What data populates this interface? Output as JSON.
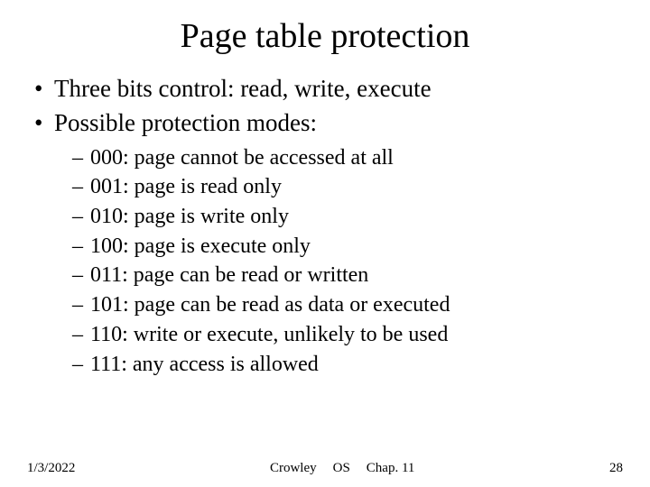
{
  "title": "Page table protection",
  "bullets": [
    "Three bits control: read, write, execute",
    "Possible protection modes:"
  ],
  "sublist": [
    "000: page cannot be accessed at all",
    "001: page is read only",
    "010: page is write only",
    "100: page is execute only",
    "011: page can be read or written",
    "101: page can be read as data or executed",
    "110: write or execute, unlikely to be used",
    "111: any access is allowed"
  ],
  "footer": {
    "date": "1/3/2022",
    "author": "Crowley",
    "subject": "OS",
    "chapter": "Chap. 11",
    "page": "28"
  }
}
